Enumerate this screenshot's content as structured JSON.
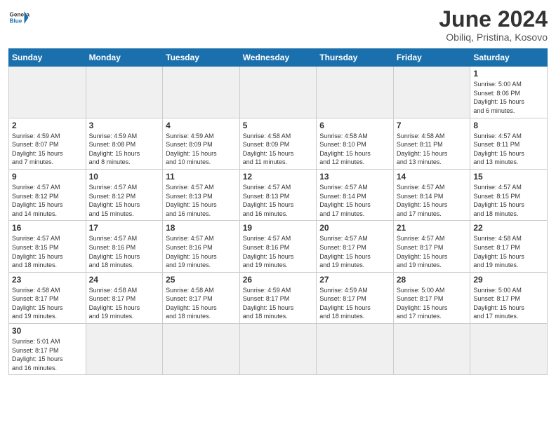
{
  "header": {
    "logo_general": "General",
    "logo_blue": "Blue",
    "title": "June 2024",
    "subtitle": "Obiliq, Pristina, Kosovo"
  },
  "weekdays": [
    "Sunday",
    "Monday",
    "Tuesday",
    "Wednesday",
    "Thursday",
    "Friday",
    "Saturday"
  ],
  "weeks": [
    [
      {
        "day": "",
        "empty": true
      },
      {
        "day": "",
        "empty": true
      },
      {
        "day": "",
        "empty": true
      },
      {
        "day": "",
        "empty": true
      },
      {
        "day": "",
        "empty": true
      },
      {
        "day": "",
        "empty": true
      },
      {
        "day": "1",
        "info": "Sunrise: 5:00 AM\nSunset: 8:06 PM\nDaylight: 15 hours\nand 6 minutes."
      }
    ],
    [
      {
        "day": "2",
        "info": "Sunrise: 4:59 AM\nSunset: 8:07 PM\nDaylight: 15 hours\nand 7 minutes."
      },
      {
        "day": "3",
        "info": "Sunrise: 4:59 AM\nSunset: 8:08 PM\nDaylight: 15 hours\nand 8 minutes."
      },
      {
        "day": "4",
        "info": "Sunrise: 4:59 AM\nSunset: 8:09 PM\nDaylight: 15 hours\nand 10 minutes."
      },
      {
        "day": "5",
        "info": "Sunrise: 4:58 AM\nSunset: 8:09 PM\nDaylight: 15 hours\nand 11 minutes."
      },
      {
        "day": "6",
        "info": "Sunrise: 4:58 AM\nSunset: 8:10 PM\nDaylight: 15 hours\nand 12 minutes."
      },
      {
        "day": "7",
        "info": "Sunrise: 4:58 AM\nSunset: 8:11 PM\nDaylight: 15 hours\nand 13 minutes."
      },
      {
        "day": "8",
        "info": "Sunrise: 4:57 AM\nSunset: 8:11 PM\nDaylight: 15 hours\nand 13 minutes."
      }
    ],
    [
      {
        "day": "9",
        "info": "Sunrise: 4:57 AM\nSunset: 8:12 PM\nDaylight: 15 hours\nand 14 minutes."
      },
      {
        "day": "10",
        "info": "Sunrise: 4:57 AM\nSunset: 8:12 PM\nDaylight: 15 hours\nand 15 minutes."
      },
      {
        "day": "11",
        "info": "Sunrise: 4:57 AM\nSunset: 8:13 PM\nDaylight: 15 hours\nand 16 minutes."
      },
      {
        "day": "12",
        "info": "Sunrise: 4:57 AM\nSunset: 8:13 PM\nDaylight: 15 hours\nand 16 minutes."
      },
      {
        "day": "13",
        "info": "Sunrise: 4:57 AM\nSunset: 8:14 PM\nDaylight: 15 hours\nand 17 minutes."
      },
      {
        "day": "14",
        "info": "Sunrise: 4:57 AM\nSunset: 8:14 PM\nDaylight: 15 hours\nand 17 minutes."
      },
      {
        "day": "15",
        "info": "Sunrise: 4:57 AM\nSunset: 8:15 PM\nDaylight: 15 hours\nand 18 minutes."
      }
    ],
    [
      {
        "day": "16",
        "info": "Sunrise: 4:57 AM\nSunset: 8:15 PM\nDaylight: 15 hours\nand 18 minutes."
      },
      {
        "day": "17",
        "info": "Sunrise: 4:57 AM\nSunset: 8:16 PM\nDaylight: 15 hours\nand 18 minutes."
      },
      {
        "day": "18",
        "info": "Sunrise: 4:57 AM\nSunset: 8:16 PM\nDaylight: 15 hours\nand 19 minutes."
      },
      {
        "day": "19",
        "info": "Sunrise: 4:57 AM\nSunset: 8:16 PM\nDaylight: 15 hours\nand 19 minutes."
      },
      {
        "day": "20",
        "info": "Sunrise: 4:57 AM\nSunset: 8:17 PM\nDaylight: 15 hours\nand 19 minutes."
      },
      {
        "day": "21",
        "info": "Sunrise: 4:57 AM\nSunset: 8:17 PM\nDaylight: 15 hours\nand 19 minutes."
      },
      {
        "day": "22",
        "info": "Sunrise: 4:58 AM\nSunset: 8:17 PM\nDaylight: 15 hours\nand 19 minutes."
      }
    ],
    [
      {
        "day": "23",
        "info": "Sunrise: 4:58 AM\nSunset: 8:17 PM\nDaylight: 15 hours\nand 19 minutes."
      },
      {
        "day": "24",
        "info": "Sunrise: 4:58 AM\nSunset: 8:17 PM\nDaylight: 15 hours\nand 19 minutes."
      },
      {
        "day": "25",
        "info": "Sunrise: 4:58 AM\nSunset: 8:17 PM\nDaylight: 15 hours\nand 18 minutes."
      },
      {
        "day": "26",
        "info": "Sunrise: 4:59 AM\nSunset: 8:17 PM\nDaylight: 15 hours\nand 18 minutes."
      },
      {
        "day": "27",
        "info": "Sunrise: 4:59 AM\nSunset: 8:17 PM\nDaylight: 15 hours\nand 18 minutes."
      },
      {
        "day": "28",
        "info": "Sunrise: 5:00 AM\nSunset: 8:17 PM\nDaylight: 15 hours\nand 17 minutes."
      },
      {
        "day": "29",
        "info": "Sunrise: 5:00 AM\nSunset: 8:17 PM\nDaylight: 15 hours\nand 17 minutes."
      }
    ],
    [
      {
        "day": "30",
        "info": "Sunrise: 5:01 AM\nSunset: 8:17 PM\nDaylight: 15 hours\nand 16 minutes."
      },
      {
        "day": "",
        "empty": true
      },
      {
        "day": "",
        "empty": true
      },
      {
        "day": "",
        "empty": true
      },
      {
        "day": "",
        "empty": true
      },
      {
        "day": "",
        "empty": true
      },
      {
        "day": "",
        "empty": true
      }
    ]
  ]
}
